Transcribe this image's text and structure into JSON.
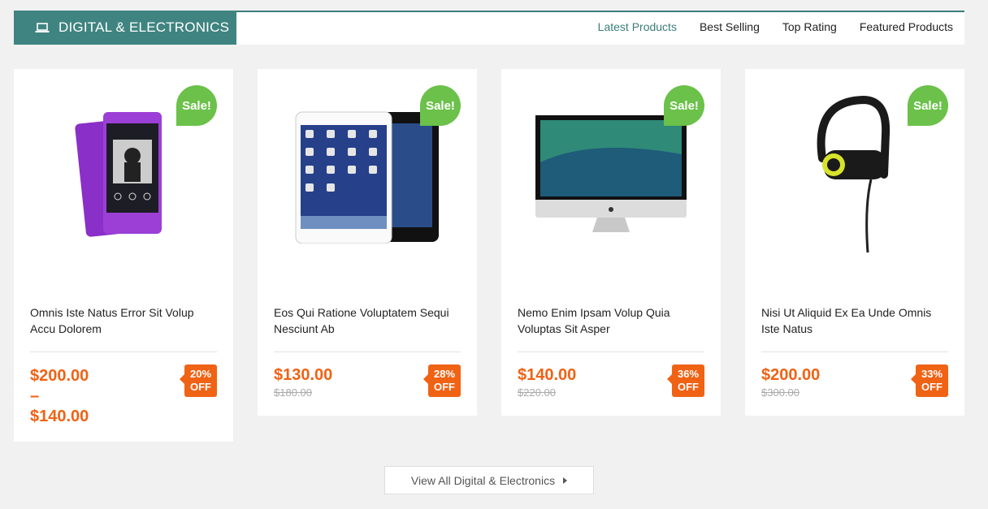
{
  "header": {
    "title": "DIGITAL & ELECTRONICS",
    "icon": "laptop-icon",
    "tabs": [
      {
        "label": "Latest Products",
        "active": true
      },
      {
        "label": "Best Selling",
        "active": false
      },
      {
        "label": "Top Rating",
        "active": false
      },
      {
        "label": "Featured Products",
        "active": false
      }
    ]
  },
  "products": [
    {
      "name": "Omnis Iste Natus Error Sit Volup Accu Dolorem",
      "badge": "Sale!",
      "price_low": "$200.00",
      "range_sep": "–",
      "price_high": "$140.00",
      "discount_pct": "20%",
      "discount_off": "OFF",
      "image": "smartphone"
    },
    {
      "name": "Eos Qui Ratione Voluptatem Sequi Nesciunt Ab",
      "badge": "Sale!",
      "price": "$130.00",
      "old_price": "$180.00",
      "discount_pct": "28%",
      "discount_off": "OFF",
      "image": "tablet"
    },
    {
      "name": "Nemo Enim Ipsam Volup Quia Voluptas Sit Asper",
      "badge": "Sale!",
      "price": "$140.00",
      "old_price": "$220.00",
      "discount_pct": "36%",
      "discount_off": "OFF",
      "image": "desktop-computer"
    },
    {
      "name": "Nisi Ut Aliquid Ex Ea Unde Omnis Iste Natus",
      "badge": "Sale!",
      "price": "$200.00",
      "old_price": "$300.00",
      "discount_pct": "33%",
      "discount_off": "OFF",
      "image": "earphones"
    }
  ],
  "view_all": {
    "label": "View All Digital & Electronics"
  },
  "colors": {
    "accent": "#3f8480",
    "sale": "#6bc14a",
    "price": "#f06214"
  }
}
